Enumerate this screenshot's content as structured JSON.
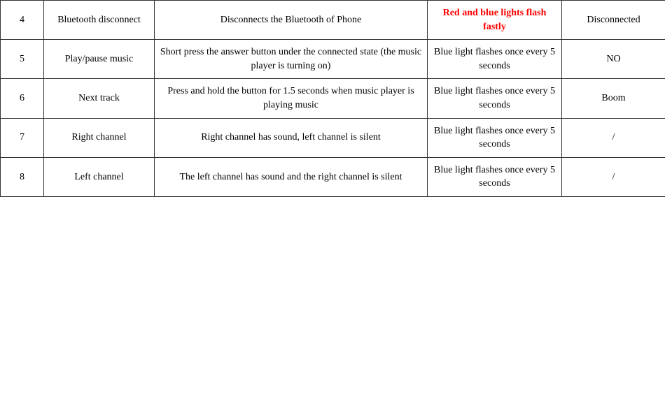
{
  "rows": [
    {
      "num": "4",
      "name": "Bluetooth disconnect",
      "description": "Disconnects the Bluetooth of Phone",
      "indicator": "Red and blue lights flash fastly",
      "indicator_style": "red-bold",
      "result": "Disconnected"
    },
    {
      "num": "5",
      "name": "Play/pause music",
      "description": "Short press the answer button under the connected state (the music player is turning on)",
      "indicator": "Blue light flashes once every 5 seconds",
      "indicator_style": "",
      "result": "NO"
    },
    {
      "num": "6",
      "name": "Next track",
      "description": "Press and hold the button for 1.5 seconds when music player is playing music",
      "indicator": "Blue light flashes once every 5 seconds",
      "indicator_style": "",
      "result": "Boom"
    },
    {
      "num": "7",
      "name": "Right channel",
      "description": "Right channel has sound, left channel is silent",
      "indicator": "Blue light flashes once every 5 seconds",
      "indicator_style": "",
      "result": "/"
    },
    {
      "num": "8",
      "name": "Left channel",
      "description": "The left channel has sound and the right channel is silent",
      "indicator": "Blue light flashes once every 5 seconds",
      "indicator_style": "",
      "result": "/"
    }
  ]
}
